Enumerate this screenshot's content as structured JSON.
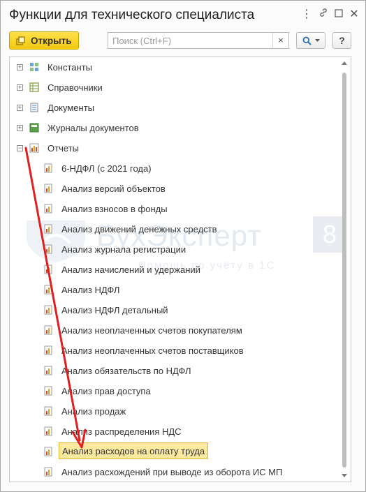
{
  "window": {
    "title": "Функции для технического специалиста",
    "more_icon": "⋮",
    "link_icon": "🔗",
    "maximize_icon": "□",
    "close_icon": "✕"
  },
  "toolbar": {
    "open_label": "Открыть",
    "search_placeholder": "Поиск (Ctrl+F)",
    "search_value": "",
    "clear_icon": "×",
    "help_label": "?"
  },
  "watermark": {
    "title": "БухЭксперт",
    "subtitle": "Помощь по учёту в 1С",
    "badge": "8"
  },
  "tree": {
    "groups": [
      {
        "label": "Константы",
        "icon": "constants-icon",
        "expander": "+"
      },
      {
        "label": "Справочники",
        "icon": "catalogs-icon",
        "expander": "+"
      },
      {
        "label": "Документы",
        "icon": "documents-icon",
        "expander": "+"
      },
      {
        "label": "Журналы документов",
        "icon": "journals-icon",
        "expander": "+"
      },
      {
        "label": "Отчеты",
        "icon": "reports-icon",
        "expander": "−"
      }
    ],
    "reports": [
      "6-НДФЛ (с 2021 года)",
      "Анализ версий объектов",
      "Анализ взносов в фонды",
      "Анализ движений денежных средств",
      "Анализ журнала регистрации",
      "Анализ начислений и удержаний",
      "Анализ НДФЛ",
      "Анализ НДФЛ детальный",
      "Анализ неоплаченных счетов покупателям",
      "Анализ неоплаченных счетов поставщиков",
      "Анализ обязательств по НДФЛ",
      "Анализ прав доступа",
      "Анализ продаж",
      "Анализ распределения НДС",
      "Анализ расходов на оплату труда",
      "Анализ расхождений при выводе из оборота ИС МП"
    ],
    "selected_index": 14
  },
  "colors": {
    "accent_yellow": "#f5cf1d",
    "selection_bg": "#fbe9a0",
    "selection_border": "#e0b829",
    "arrow_red": "#e02020"
  }
}
